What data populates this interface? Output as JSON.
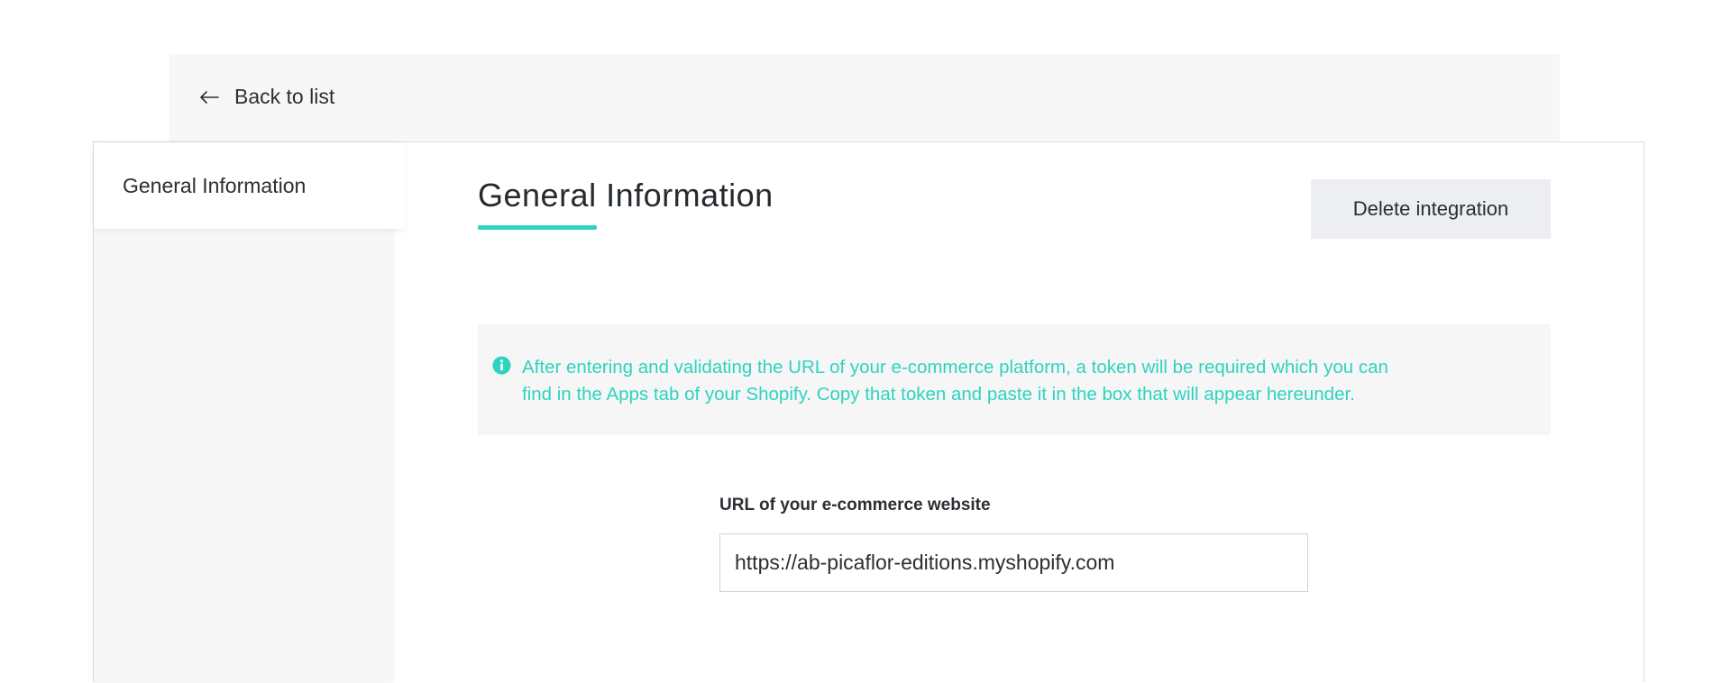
{
  "header": {
    "back_label": "Back to list",
    "back_icon": "arrow-left-icon"
  },
  "sidebar": {
    "items": [
      {
        "label": "General Information",
        "active": true
      }
    ]
  },
  "main": {
    "title": "General Information",
    "accent_color": "#2ed3bf",
    "delete_label": "Delete integration",
    "info": {
      "icon": "info-icon",
      "text_line1": "After entering and validating the URL of your e-commerce platform, a token will be required which you can",
      "text_line2": "find in the Apps tab of your Shopify. Copy that token and paste it in the box that will appear hereunder."
    },
    "url_field": {
      "label": "URL of your e-commerce website",
      "value": "https://ab-picaflor-editions.myshopify.com"
    }
  }
}
